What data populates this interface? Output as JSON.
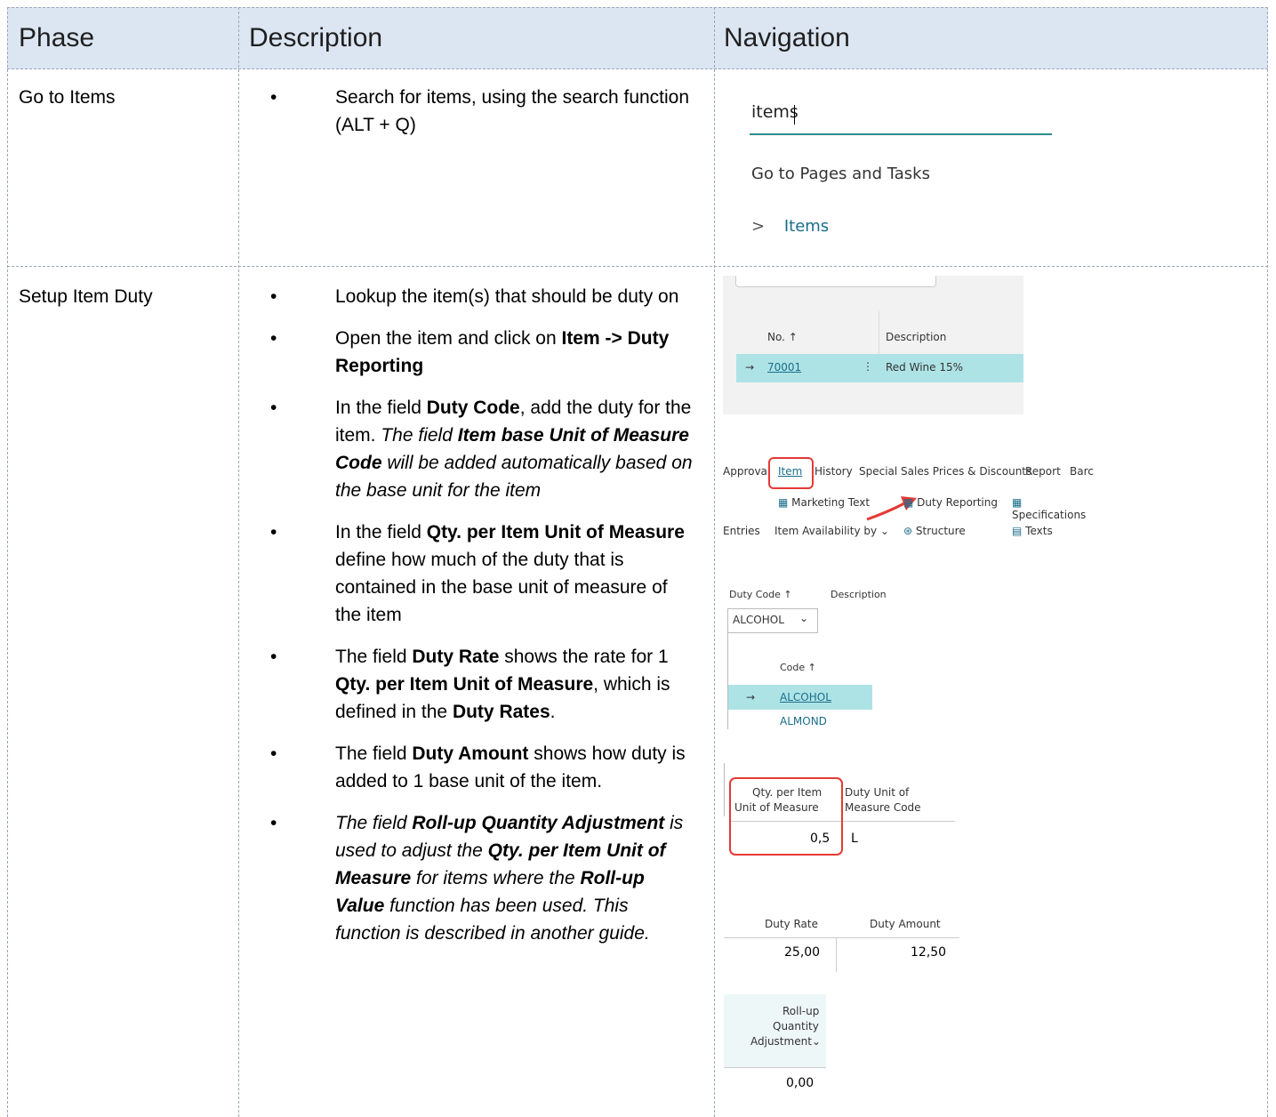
{
  "headers": {
    "phase": "Phase",
    "description": "Description",
    "navigation": "Navigation"
  },
  "row1": {
    "phase": "Go to Items",
    "desc": "Search for items, using the search function (ALT + Q)",
    "nav": {
      "search_value": "items",
      "section": "Go to Pages and Tasks",
      "result": "Items"
    }
  },
  "row2": {
    "phase": "Setup Item Duty",
    "b1": "Lookup the item(s) that should be duty on",
    "b2": {
      "t1": "Open the item and click on ",
      "bold": "Item -> Duty Reporting"
    },
    "b3": {
      "t1": "In the field ",
      "bold1": "Duty Code",
      "t2": ", add the duty for the item. ",
      "i1": "The field ",
      "bi1": "Item base Unit of Measure Code",
      "i2": " will be added automatically based on the base unit for the item"
    },
    "b4": {
      "t1": "In the field ",
      "bold1": "Qty. per Item Unit of Measure",
      "t2": " define how much of the duty that is contained in the base unit of measure of the item"
    },
    "b5": {
      "t1": "The field ",
      "bold1": "Duty Rate",
      "t2": " shows the rate for 1 ",
      "bold2": "Qty. per Item Unit of Measure",
      "t3": ", which is defined in the ",
      "bold3": "Duty Rates",
      "t4": "."
    },
    "b6": {
      "t1": "The field ",
      "bold1": "Duty Amount",
      "t2": " shows how duty is added to 1 base unit of the item."
    },
    "b7": {
      "i1": "The field ",
      "bi1": "Roll-up Quantity Adjustment",
      "i2": " is used to adjust the ",
      "bi2": "Qty. per Item Unit of Measure",
      "i3": " for items where the ",
      "bi3": "Roll-up Value",
      "i4": " function has been used. This function is described in another guide."
    },
    "nav": {
      "item_list": {
        "col_no": "No. ↑",
        "col_desc": "Description",
        "no": "70001",
        "desc": "Red Wine 15%"
      },
      "ribbon": {
        "tabs": [
          "Approval",
          "Item",
          "History",
          "Special Sales Prices & Discounts",
          "Report",
          "Barc"
        ],
        "row1": [
          "Marketing Text",
          "Duty Reporting",
          "Specifications"
        ],
        "row2": [
          "Entries",
          "Item Availability by",
          "Structure",
          "Texts"
        ]
      },
      "duty_code": {
        "col1": "Duty Code ↑",
        "col2": "Description",
        "value": "ALCOHOL",
        "dd_header": "Code ↑",
        "options": [
          "ALCOHOL",
          "ALMOND"
        ]
      },
      "qty": {
        "h1": "Qty. per Item",
        "h2": "Unit of Measure",
        "h3": "Duty Unit of",
        "h4": "Measure Code",
        "value": "0,5",
        "uom": "L"
      },
      "rate": {
        "h1": "Duty Rate",
        "h2": "Duty Amount",
        "rate": "25,00",
        "amount": "12,50"
      },
      "rollup": {
        "h1": "Roll-up",
        "h2": "Quantity",
        "h3": "Adjustment",
        "value": "0,00"
      }
    }
  },
  "colors": {
    "header_bg": "#dce6f2",
    "highlight": "#aee3e6",
    "accent": "#1a6e8a",
    "red": "#e53935"
  }
}
